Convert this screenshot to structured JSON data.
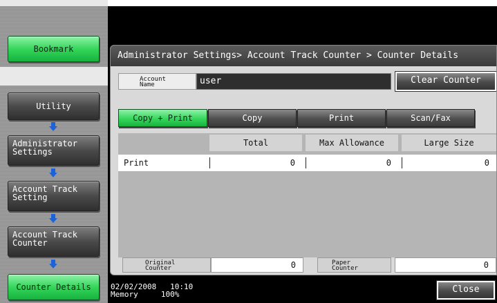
{
  "sidebar": {
    "bookmark": "Bookmark",
    "utility": "Utility",
    "admin_line1": "Administrator",
    "admin_line2": "Settings",
    "acct_setting_line1": "Account Track",
    "acct_setting_line2": "Setting",
    "acct_counter_line1": "Account Track",
    "acct_counter_line2": "Counter",
    "counter_details": "Counter Details",
    "arrow_icon": "down-arrow-icon",
    "accent_color": "#2ecc55"
  },
  "header": {
    "breadcrumb": "Administrator Settings> Account Track Counter > Counter Details"
  },
  "account": {
    "label_line1": "Account",
    "label_line2": "Name",
    "value": "user",
    "clear_button": "Clear Counter"
  },
  "tabs": [
    {
      "label": "Copy + Print",
      "active": true
    },
    {
      "label": "Copy",
      "active": false
    },
    {
      "label": "Print",
      "active": false
    },
    {
      "label": "Scan/Fax",
      "active": false
    }
  ],
  "table": {
    "columns": [
      "",
      "Total",
      "Max Allowance",
      "Large Size"
    ],
    "rows": [
      {
        "label": "Print",
        "total": "0",
        "max_allowance": "0",
        "large_size": "0"
      }
    ]
  },
  "counters": {
    "original_line1": "Original",
    "original_line2": "Counter",
    "original_value": "0",
    "paper_line1": "Paper",
    "paper_line2": "Counter",
    "paper_value": "0"
  },
  "status": {
    "date": "02/02/2008",
    "time": "10:10",
    "memory_label": "Memory",
    "memory_value": "100%"
  },
  "close_button": "Close"
}
